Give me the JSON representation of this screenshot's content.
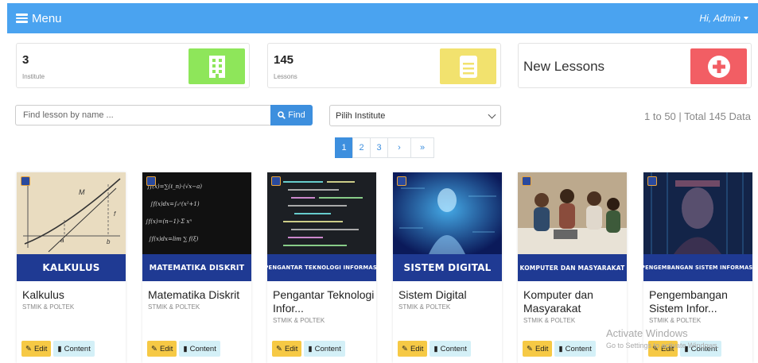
{
  "navbar": {
    "menu_label": "Menu",
    "user_label": "Hi, Admin"
  },
  "stats": [
    {
      "number": "3",
      "label": "Institute",
      "color": "#8ee65a",
      "icon": "building-icon"
    },
    {
      "number": "145",
      "label": "Lessons",
      "color": "#f2e26e",
      "icon": "document-icon"
    },
    {
      "title": "New Lessons",
      "color": "#f25e64",
      "icon": "plus-circle-icon"
    }
  ],
  "search": {
    "placeholder": "Find lesson by name ...",
    "button_label": "Find"
  },
  "filter": {
    "selected": "Pilih Institute"
  },
  "total_text": "1 to 50 | Total 145 Data",
  "pagination": [
    "1",
    "2",
    "3",
    "›",
    "»"
  ],
  "cards": [
    {
      "band": "KALKULUS",
      "title": "Kalkulus",
      "sub": "STMIK & POLTEK",
      "edit": "Edit",
      "content": "Content"
    },
    {
      "band": "MATEMATIKA DISKRIT",
      "title": "Matematika Diskrit",
      "sub": "STMIK & POLTEK",
      "edit": "Edit",
      "content": "Content"
    },
    {
      "band": "PENGANTAR TEKNOLOGI INFORMASI",
      "title": "Pengantar Teknologi Infor...",
      "sub": "STMIK & POLTEK",
      "edit": "Edit",
      "content": "Content"
    },
    {
      "band": "SISTEM DIGITAL",
      "title": "Sistem Digital",
      "sub": "STMIK & POLTEK",
      "edit": "Edit",
      "content": "Content"
    },
    {
      "band": "KOMPUTER DAN MASYARAKAT",
      "title": "Komputer dan Masyarakat",
      "sub": "STMIK & POLTEK",
      "edit": "Edit",
      "content": "Content"
    },
    {
      "band": "PENGEMBANGAN SISTEM INFORMASI",
      "title": "Pengembangan Sistem Infor...",
      "sub": "STMIK & POLTEK",
      "edit": "Edit",
      "content": "Content"
    }
  ],
  "watermark": {
    "line1": "Activate Windows",
    "line2": "Go to Settings to activate Windows."
  }
}
